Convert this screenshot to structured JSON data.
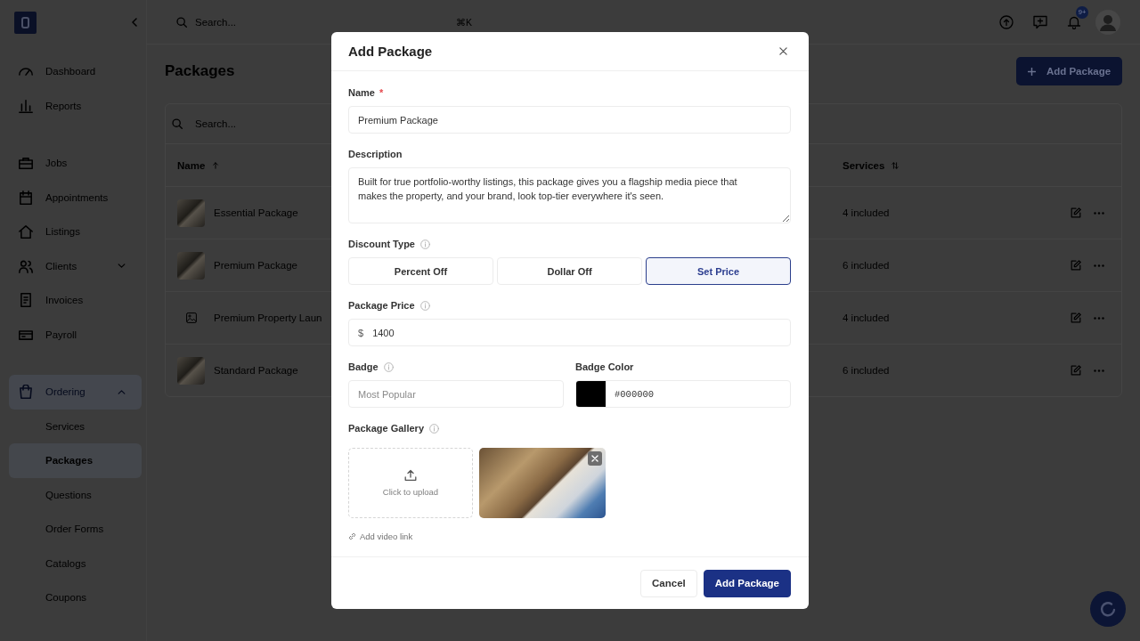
{
  "sidebar": {
    "sections": [
      {
        "items": [
          {
            "label": "Dashboard",
            "kind": "link",
            "selected": false
          },
          {
            "label": "Reports",
            "kind": "link",
            "selected": false
          }
        ]
      },
      {
        "items": [
          {
            "label": "Jobs",
            "kind": "link",
            "selected": false
          },
          {
            "label": "Appointments",
            "kind": "link",
            "selected": false
          },
          {
            "label": "Listings",
            "kind": "link",
            "selected": false
          },
          {
            "label": "Clients",
            "kind": "group",
            "selected": false,
            "expanded": false
          },
          {
            "label": "Invoices",
            "kind": "link",
            "selected": false
          },
          {
            "label": "Payroll",
            "kind": "link",
            "selected": false
          }
        ]
      },
      {
        "items": [
          {
            "label": "Ordering",
            "kind": "group",
            "selected": true,
            "expanded": true,
            "children": [
              {
                "label": "Services",
                "selected": false
              },
              {
                "label": "Packages",
                "selected": true
              },
              {
                "label": "Questions",
                "selected": false
              },
              {
                "label": "Order Forms",
                "selected": false
              },
              {
                "label": "Catalogs",
                "selected": false
              },
              {
                "label": "Coupons",
                "selected": false
              }
            ]
          }
        ]
      }
    ]
  },
  "topbar": {
    "search": {
      "placeholder": "Search...",
      "shortcut": "⌘K"
    },
    "notification_count": "9+"
  },
  "page": {
    "title": "Packages",
    "add_button": "Add Package",
    "search": {
      "placeholder": "Search..."
    },
    "table": {
      "columns": [
        {
          "label": "Name",
          "sorted": true
        },
        {
          "label": "Services",
          "sorted": false
        }
      ],
      "rows": [
        {
          "name": "Essential Package",
          "photo": true,
          "services": "4 included"
        },
        {
          "name": "Premium Package",
          "photo": true,
          "services": "6 included"
        },
        {
          "name": "Premium Property Laun",
          "photo": false,
          "services": "4 included"
        },
        {
          "name": "Standard Package",
          "photo": true,
          "services": "6 included"
        }
      ]
    }
  },
  "modal": {
    "title": "Add Package",
    "name": {
      "label": "Name",
      "required_mark": "*",
      "value": "Premium Package"
    },
    "description": {
      "label": "Description",
      "value": "Built for true portfolio-worthy listings, this package gives you a flagship media piece that makes the property, and your brand, look top-tier everywhere it's seen."
    },
    "discount_type": {
      "label": "Discount Type",
      "hint": true,
      "options": [
        {
          "label": "Percent Off",
          "selected": false
        },
        {
          "label": "Dollar Off",
          "selected": false
        },
        {
          "label": "Set Price",
          "selected": true
        }
      ]
    },
    "package_price": {
      "label": "Package Price",
      "hint": true,
      "prefix": "$",
      "value": "1400"
    },
    "badge": {
      "label": "Badge",
      "hint": true,
      "placeholder": "Most Popular"
    },
    "badge_color": {
      "label": "Badge Color",
      "value": "#000000"
    },
    "gallery": {
      "label": "Package Gallery",
      "hint": true,
      "upload_label": "Click to upload",
      "photos": [
        {
          "removable": true
        }
      ]
    },
    "video_link": "Add video link",
    "buttons": [
      {
        "label": "Cancel",
        "kind": "cancel"
      },
      {
        "label": "Add Package",
        "kind": "submit"
      }
    ]
  }
}
